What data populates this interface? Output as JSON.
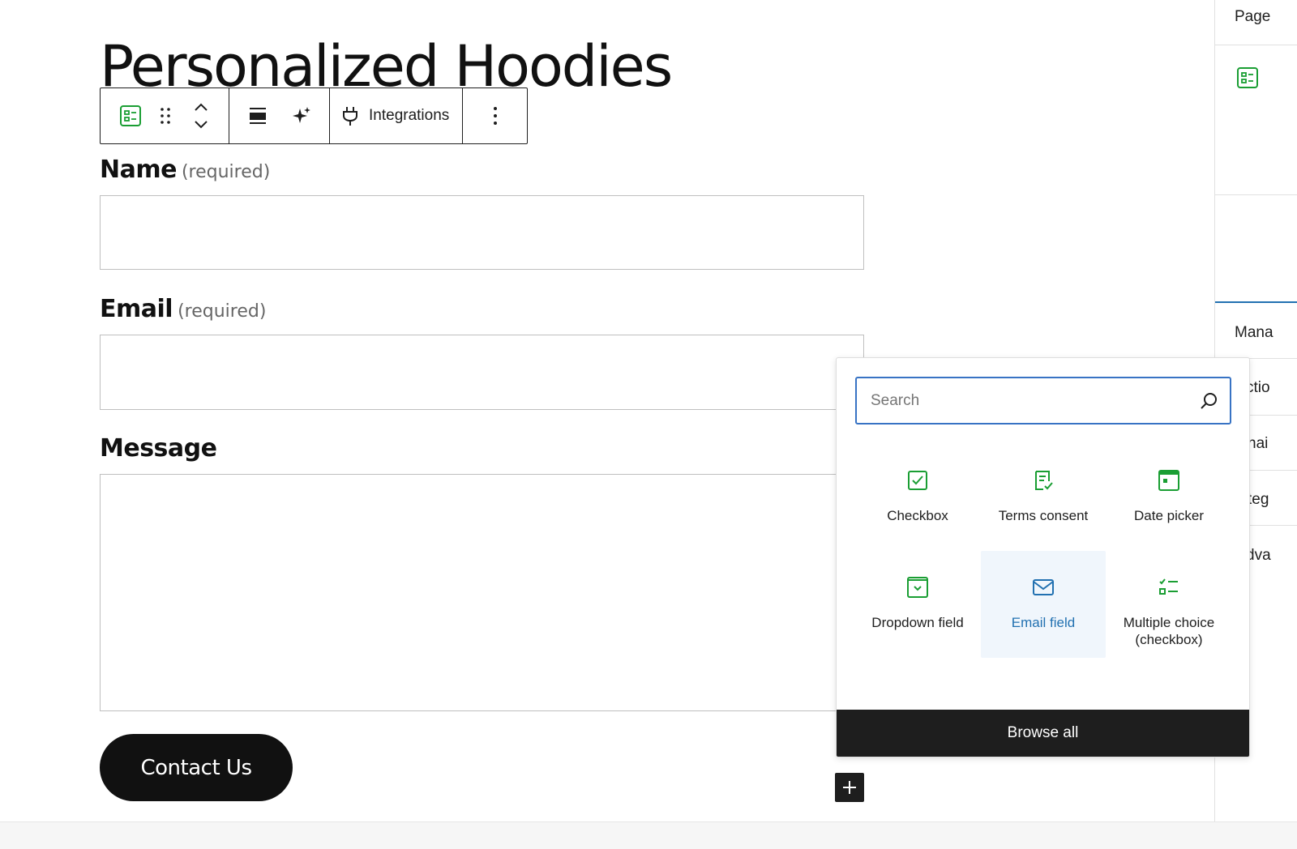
{
  "page": {
    "title": "Personalized Hoodies"
  },
  "toolbar": {
    "integrations_label": "Integrations"
  },
  "form": {
    "fields": [
      {
        "label": "Name",
        "required_text": "(required)"
      },
      {
        "label": "Email",
        "required_text": "(required)"
      },
      {
        "label": "Message"
      }
    ],
    "submit_label": "Contact Us"
  },
  "sidebar": {
    "tab_label": "Page",
    "rows": [
      "Mana",
      "ctio",
      "nai",
      "teg",
      "dva"
    ]
  },
  "inserter": {
    "search_placeholder": "Search",
    "items": [
      {
        "label": "Checkbox",
        "icon": "checkbox-icon"
      },
      {
        "label": "Terms consent",
        "icon": "terms-consent-icon"
      },
      {
        "label": "Date picker",
        "icon": "date-picker-icon"
      },
      {
        "label": "Dropdown field",
        "icon": "dropdown-icon"
      },
      {
        "label": "Email field",
        "icon": "envelope-icon",
        "selected": true
      },
      {
        "label": "Multiple choice (checkbox)",
        "icon": "multiple-choice-icon"
      }
    ],
    "browse_all_label": "Browse all"
  },
  "colors": {
    "accent_green": "#1a9e33",
    "accent_blue": "#2271b1",
    "dark": "#1e1e1e"
  }
}
